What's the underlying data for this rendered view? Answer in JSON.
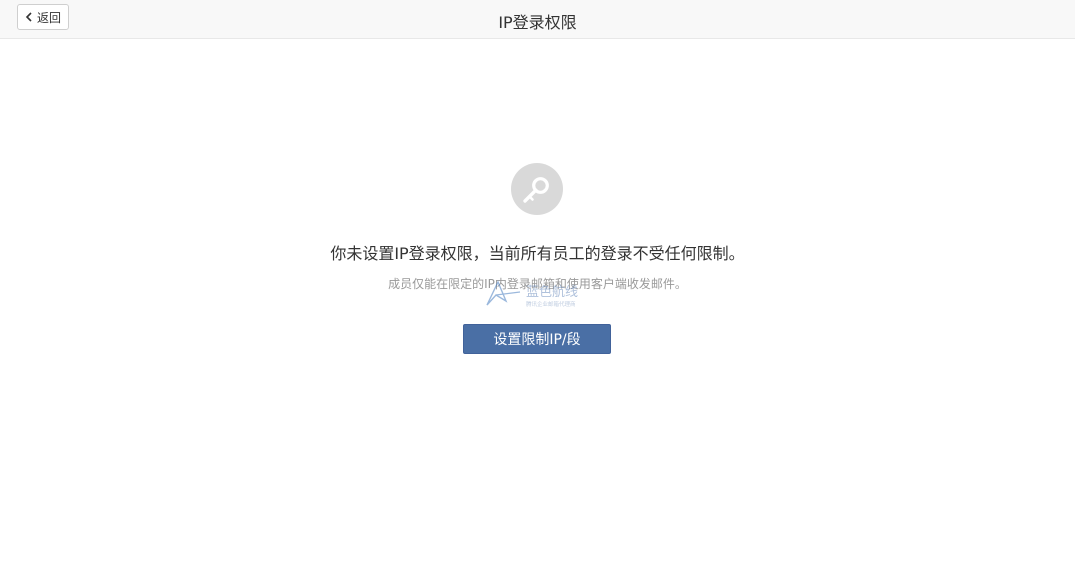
{
  "header": {
    "back_label": "返回",
    "title": "IP登录权限"
  },
  "main": {
    "icon": "key-icon",
    "message": "你未设置IP登录权限，当前所有员工的登录不受任何限制。",
    "sub_message": "成员仅能在限定的IP内登录邮箱和使用客户端收发邮件。",
    "button_label": "设置限制IP/段"
  },
  "watermark": {
    "text": "蓝色航线",
    "subtext": "腾讯企业邮箱代理商"
  },
  "colors": {
    "header_bg": "#f8f8f8",
    "primary_button": "#4a6fa5",
    "icon_circle": "#d9d9d9",
    "sub_text": "#999999"
  }
}
